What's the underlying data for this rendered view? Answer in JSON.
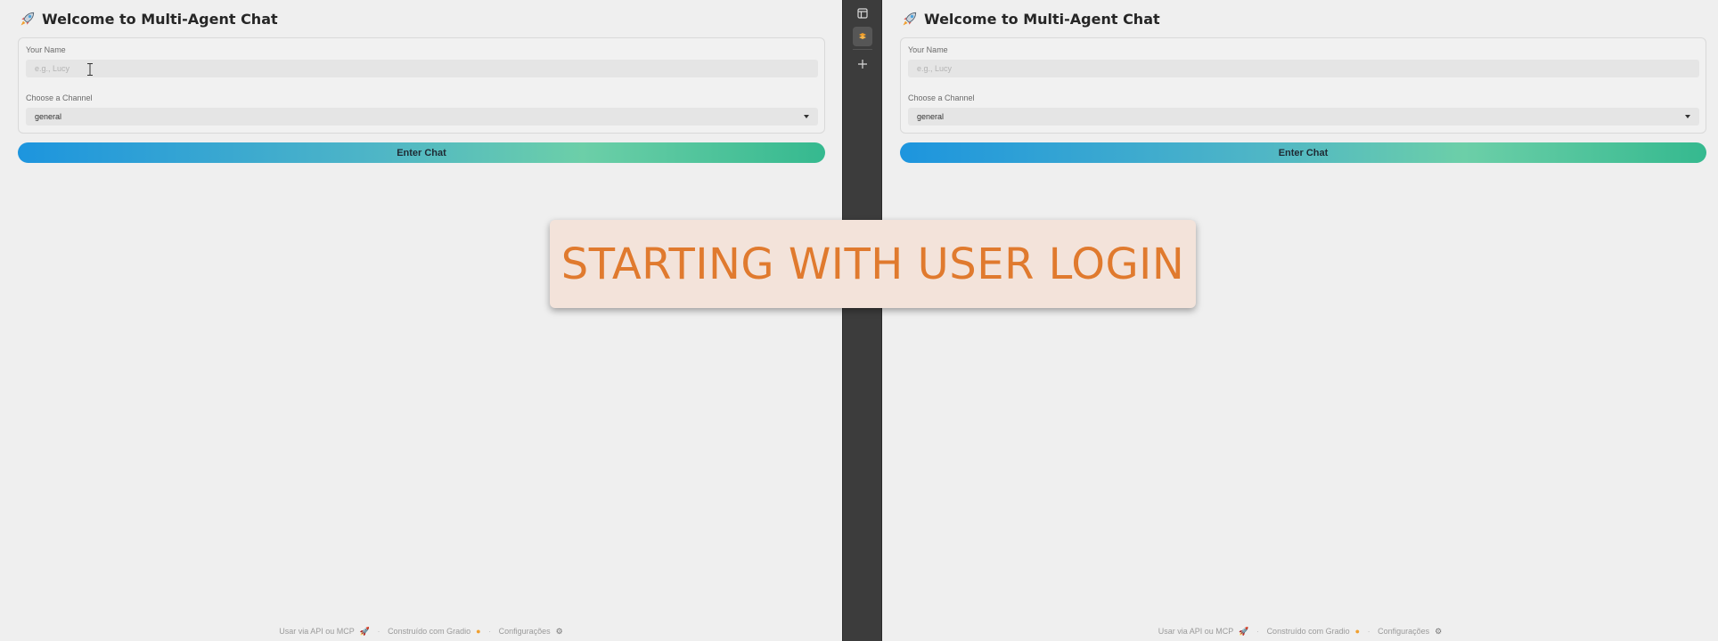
{
  "left_pane": {
    "title": "Welcome to Multi-Agent Chat",
    "name_label": "Your Name",
    "name_placeholder": "e.g., Lucy",
    "name_value": "",
    "channel_label": "Choose a Channel",
    "channel_value": "general",
    "enter_button": "Enter Chat",
    "footer": {
      "api_link": "Usar via API ou MCP",
      "built_with": "Construído com Gradio",
      "settings": "Configurações",
      "separator": "·"
    }
  },
  "right_pane": {
    "title": "Welcome to Multi-Agent Chat",
    "name_label": "Your Name",
    "name_placeholder": "e.g., Lucy",
    "name_value": "",
    "channel_label": "Choose a Channel",
    "channel_value": "general",
    "enter_button": "Enter Chat",
    "footer": {
      "api_link": "Usar via API ou MCP",
      "built_with": "Construído com Gradio",
      "settings": "Configurações",
      "separator": "·"
    }
  },
  "divider_toolbar": {
    "icons": [
      "panel-toggle-icon",
      "gradio-logo-icon",
      "add-icon"
    ]
  },
  "banner": {
    "text": "STARTING WITH USER LOGIN"
  },
  "colors": {
    "banner_text": "#e07a2e",
    "banner_bg": "#f3e3da",
    "button_gradient_start": "#1d95de",
    "button_gradient_end": "#35b98f",
    "pane_bg": "#efefef",
    "divider_bg": "#3c3c3c"
  }
}
